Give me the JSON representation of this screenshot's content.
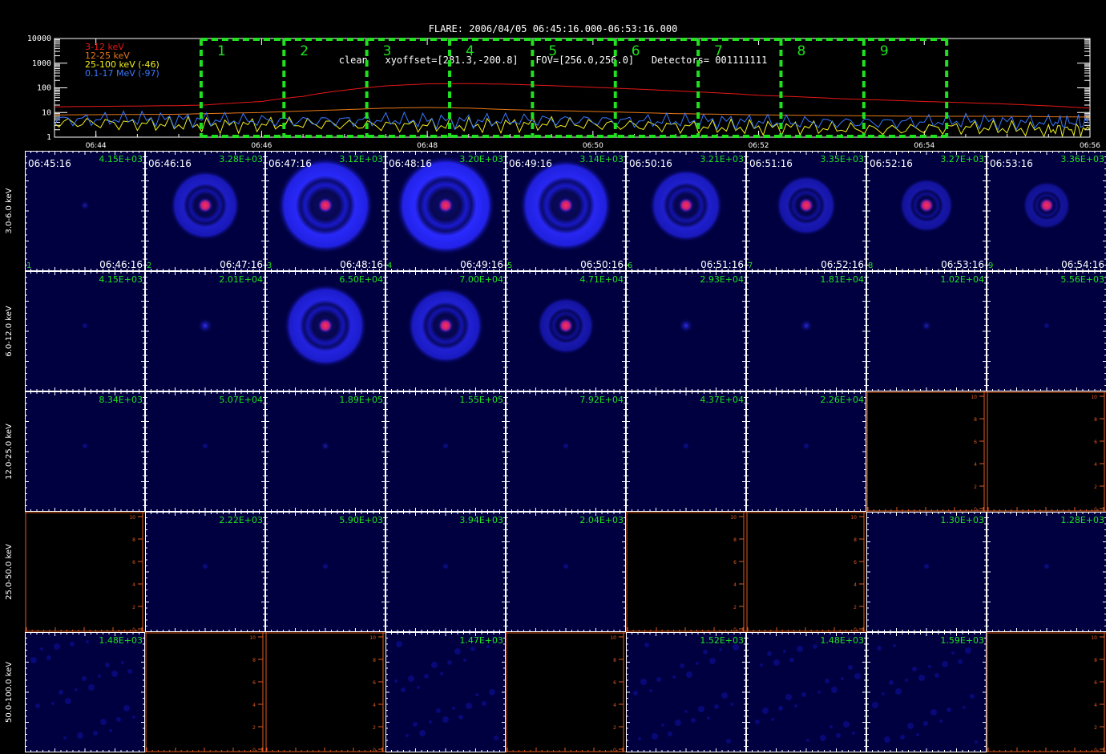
{
  "header": {
    "title_line1": "FLARE: 2006/04/05 06:45:16.000-06:53:16.000",
    "title_line2": "clean   xyoffset=[281.3,-200.8]   FOV=[256.0,256.0]   Detectors= 001111111"
  },
  "lightcurve": {
    "y_ticks": [
      "10000",
      "1000",
      "100",
      "10",
      "1"
    ],
    "x_ticks": [
      "06:44",
      "06:46",
      "06:48",
      "06:50",
      "06:52",
      "06:54",
      "06:56"
    ],
    "legend": [
      {
        "label": "3-12 keV",
        "color": "#e81818"
      },
      {
        "label": "12-25 keV",
        "color": "#e87818"
      },
      {
        "label": "25-100 keV (-46)",
        "color": "#f0f020"
      },
      {
        "label": "0.1-17 MeV (-97)",
        "color": "#3878ff"
      }
    ],
    "intervals": [
      "1",
      "2",
      "3",
      "4",
      "5",
      "6",
      "7",
      "8",
      "9"
    ],
    "interval_color": "#20e020",
    "y_range": [
      1,
      10000
    ],
    "log_scale": true,
    "x_range_min": [
      43.5,
      56
    ],
    "interval_start_min": 45.27,
    "interval_step_min": 1,
    "series": [
      {
        "name": "3-12 keV",
        "times_min": [
          43.5,
          45.0,
          45.3,
          46.0,
          46.5,
          47.0,
          47.5,
          48.0,
          48.5,
          49.0,
          50.0,
          51.0,
          52.0,
          53.0,
          54.0,
          55.0,
          56.0
        ],
        "values": [
          17,
          19,
          20,
          28,
          45,
          80,
          120,
          145,
          148,
          140,
          105,
          75,
          50,
          36,
          28,
          22,
          15
        ]
      },
      {
        "name": "12-25 keV",
        "times_min": [
          43.5,
          45.0,
          46.0,
          47.0,
          47.5,
          48.0,
          48.5,
          49.0,
          50.0,
          51.0,
          52.0,
          53.0,
          54.0,
          55.0,
          56.0
        ],
        "values": [
          8,
          8.5,
          10,
          13,
          15,
          16,
          15,
          13,
          11,
          9,
          8,
          7.5,
          7,
          7,
          6.5
        ]
      },
      {
        "name": "25-100 keV (-46)",
        "times_min": [
          43.5,
          44.5,
          45.5,
          46.5,
          47.5,
          48.5,
          49.5,
          50.5,
          51.5,
          52.5,
          53.5,
          54.5,
          55.5,
          56.0
        ],
        "values": [
          4,
          3.5,
          3,
          3.5,
          3,
          3,
          3.5,
          3,
          2.5,
          2.5,
          2,
          2.5,
          2,
          2
        ]
      },
      {
        "name": "0.1-17 MeV (-97)",
        "times_min": [
          43.5,
          44.5,
          45.5,
          46.5,
          47.5,
          48.5,
          49.5,
          50.5,
          51.5,
          52.5,
          53.5,
          54.5,
          55.5,
          56.0
        ],
        "values": [
          5,
          5.5,
          5,
          4.5,
          5,
          4.5,
          5,
          4.5,
          4.5,
          4,
          4,
          4.5,
          4,
          4
        ]
      }
    ]
  },
  "image_grid": {
    "row_labels": [
      "3.0-6.0 keV",
      "6.0-12.0 keV",
      "12.0-25.0 keV",
      "25.0-50.0 keV",
      "50.0-100.0 keV"
    ],
    "start_times": [
      "06:45:16",
      "06:46:16",
      "06:47:16",
      "06:48:16",
      "06:49:16",
      "06:50:16",
      "06:51:16",
      "06:52:16",
      "06:53:16"
    ],
    "end_times": [
      "06:46:16",
      "06:47:16",
      "06:48:16",
      "06:49:16",
      "06:50:16",
      "06:51:16",
      "06:52:16",
      "06:53:16",
      "06:54:16"
    ],
    "interval_numbers": [
      "1",
      "2",
      "3",
      "4",
      "5",
      "6",
      "7",
      "8",
      "9"
    ],
    "empty_axis_ticks": [
      "0",
      "2",
      "4",
      "6",
      "8",
      "10"
    ],
    "value_color": "#20e020",
    "cells": [
      [
        {
          "value": "4.15E+03",
          "type": "dot",
          "level": 0.15
        },
        {
          "value": "3.28E+03",
          "type": "ring",
          "level": 0.55
        },
        {
          "value": "3.12E+03",
          "type": "ring",
          "level": 0.95
        },
        {
          "value": "3.20E+03",
          "type": "ring",
          "level": 1.0
        },
        {
          "value": "3.14E+03",
          "type": "ring",
          "level": 0.9
        },
        {
          "value": "3.21E+03",
          "type": "ring",
          "level": 0.6
        },
        {
          "value": "3.35E+03",
          "type": "ring",
          "level": 0.4
        },
        {
          "value": "3.27E+03",
          "type": "ring",
          "level": 0.3
        },
        {
          "value": "3.36E+03",
          "type": "ring",
          "level": 0.2
        }
      ],
      [
        {
          "value": "4.15E+03",
          "type": "faint",
          "level": 0.05
        },
        {
          "value": "2.01E+04",
          "type": "dot",
          "level": 0.5
        },
        {
          "value": "6.50E+04",
          "type": "ring",
          "level": 0.75
        },
        {
          "value": "7.00E+04",
          "type": "ring",
          "level": 0.65
        },
        {
          "value": "4.71E+04",
          "type": "ring",
          "level": 0.35
        },
        {
          "value": "2.93E+04",
          "type": "dot",
          "level": 0.45
        },
        {
          "value": "1.81E+04",
          "type": "dot",
          "level": 0.35
        },
        {
          "value": "1.02E+04",
          "type": "dot",
          "level": 0.2
        },
        {
          "value": "5.56E+03",
          "type": "faint",
          "level": 0.05
        }
      ],
      [
        {
          "value": "8.34E+03",
          "type": "faint",
          "level": 0.02
        },
        {
          "value": "5.07E+04",
          "type": "faint",
          "level": 0.02
        },
        {
          "value": "1.89E+05",
          "type": "dot",
          "level": 0.12
        },
        {
          "value": "1.55E+05",
          "type": "faint",
          "level": 0.02
        },
        {
          "value": "7.92E+04",
          "type": "faint",
          "level": 0.02
        },
        {
          "value": "4.37E+04",
          "type": "faint",
          "level": 0.02
        },
        {
          "value": "2.26E+04",
          "type": "faint",
          "level": 0.02
        },
        {
          "value": "",
          "type": "empty",
          "level": 0
        },
        {
          "value": "",
          "type": "empty",
          "level": 0
        }
      ],
      [
        {
          "value": "",
          "type": "empty",
          "level": 0
        },
        {
          "value": "2.22E+03",
          "type": "faint",
          "level": 0.02
        },
        {
          "value": "5.90E+03",
          "type": "faint",
          "level": 0.02
        },
        {
          "value": "3.94E+03",
          "type": "faint",
          "level": 0.02
        },
        {
          "value": "2.04E+03",
          "type": "faint",
          "level": 0.02
        },
        {
          "value": "",
          "type": "empty",
          "level": 0
        },
        {
          "value": "",
          "type": "empty",
          "level": 0
        },
        {
          "value": "1.30E+03",
          "type": "faint",
          "level": 0.02
        },
        {
          "value": "1.28E+03",
          "type": "faint",
          "level": 0.02
        }
      ],
      [
        {
          "value": "1.48E+03",
          "type": "noise",
          "level": 0.1
        },
        {
          "value": "",
          "type": "empty",
          "level": 0
        },
        {
          "value": "",
          "type": "empty",
          "level": 0
        },
        {
          "value": "1.47E+03",
          "type": "noise",
          "level": 0.1
        },
        {
          "value": "",
          "type": "empty",
          "level": 0
        },
        {
          "value": "1.52E+03",
          "type": "noise",
          "level": 0.1
        },
        {
          "value": "1.48E+03",
          "type": "noise",
          "level": 0.1
        },
        {
          "value": "1.59E+03",
          "type": "noise",
          "level": 0.1
        },
        {
          "value": "",
          "type": "empty",
          "level": 0
        }
      ]
    ]
  }
}
